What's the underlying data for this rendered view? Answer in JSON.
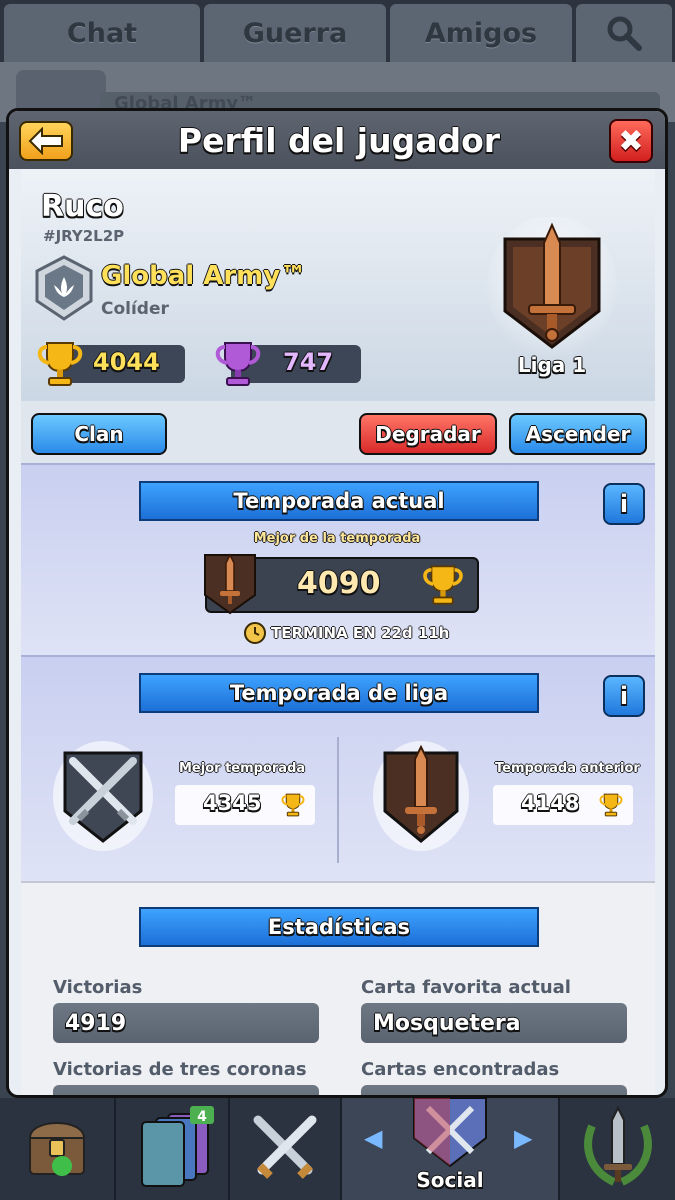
{
  "tabs": [
    "Chat",
    "Guerra",
    "Amigos"
  ],
  "background": {
    "clan_name": "Global Army™"
  },
  "header": {
    "title": "Perfil del jugador"
  },
  "player": {
    "name": "Ruco",
    "tag": "#JRY2L2P",
    "clan_name": "Global Army™",
    "clan_role": "Colíder",
    "trophies": "4044",
    "secondary_trophies": "747",
    "league_label": "Liga 1"
  },
  "buttons": {
    "clan": "Clan",
    "demote": "Degradar",
    "promote": "Ascender"
  },
  "current_season": {
    "title": "Temporada actual",
    "info": "i",
    "best_label": "Mejor de la temporada",
    "best_value": "4090",
    "ends_in": "TERMINA EN 22d 11h"
  },
  "league_season": {
    "title": "Temporada de liga",
    "info": "i",
    "best_label": "Mejor temporada",
    "best_value": "4345",
    "previous_label": "Temporada anterior",
    "previous_value": "4148"
  },
  "stats": {
    "title": "Estadísticas",
    "wins_label": "Victorias",
    "wins_value": "4919",
    "fav_label": "Carta favorita actual",
    "fav_value": "Mosquetera",
    "three_crowns_label": "Victorias de tres coronas",
    "cards_found_label": "Cartas encontradas"
  },
  "nav": {
    "active_label": "Social",
    "badge": "4"
  },
  "colors": {
    "gold": "#ffe05a",
    "blue": "#2a8bea",
    "red": "#d82a2a",
    "bronze": "#b5673a"
  }
}
